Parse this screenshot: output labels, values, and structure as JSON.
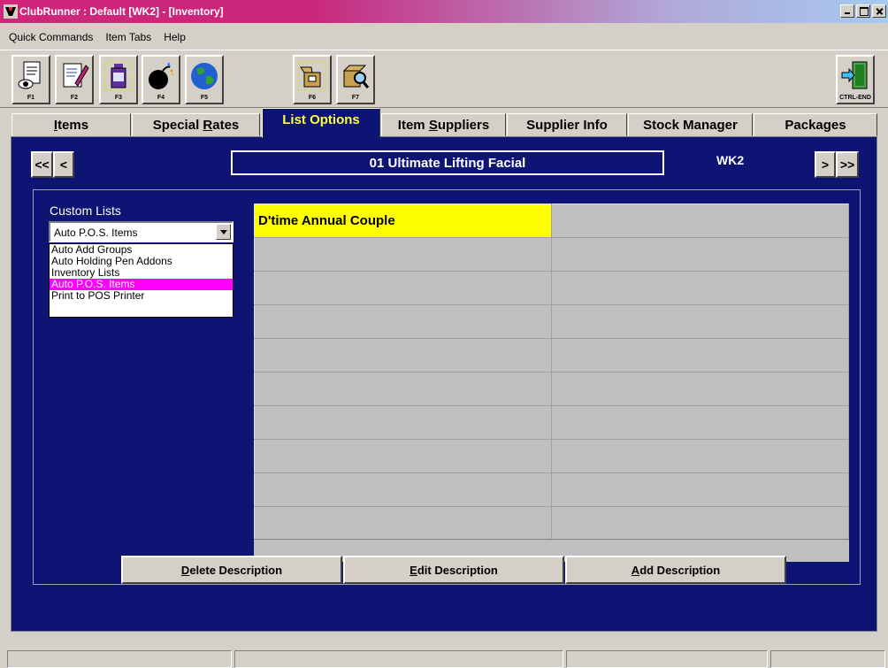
{
  "window": {
    "title": "ClubRunner : Default [WK2] - [Inventory]"
  },
  "menu": {
    "items": [
      "Quick Commands",
      "Item Tabs",
      "Help"
    ]
  },
  "toolbar": {
    "buttons": [
      {
        "key": "F1",
        "icon": "view-document-icon"
      },
      {
        "key": "F2",
        "icon": "edit-document-icon"
      },
      {
        "key": "F3",
        "icon": "inventory-bottle-icon"
      },
      {
        "key": "F4",
        "icon": "bomb-icon"
      },
      {
        "key": "F5",
        "icon": "globe-icon"
      },
      {
        "key": "F6",
        "icon": "open-box-icon"
      },
      {
        "key": "F7",
        "icon": "search-box-icon"
      }
    ],
    "exit_key": "CTRL-END"
  },
  "tabs": {
    "items": {
      "accel": "I",
      "rest": "tems"
    },
    "special_rates": {
      "before": "Special ",
      "accel": "R",
      "rest": "ates"
    },
    "list_options": "List Options",
    "item_suppliers": {
      "before": "Item ",
      "accel": "S",
      "rest": "uppliers"
    },
    "supplier_info": "Supplier Info",
    "stock_manager": "Stock Manager",
    "packages": "Packages"
  },
  "nav": {
    "first": "<<",
    "prev": "<",
    "next": ">",
    "last": ">>",
    "item_title": "01 Ultimate Lifting Facial",
    "workstation": "WK2"
  },
  "custom_lists": {
    "label": "Custom Lists",
    "selected": "Auto P.O.S. Items",
    "options": [
      "Auto Add Groups",
      "Auto Holding Pen Addons",
      "Inventory Lists",
      "Auto P.O.S. Items",
      "Print to POS Printer"
    ],
    "selected_index": 3
  },
  "grid": {
    "rows": [
      [
        "D'time Annual Couple",
        ""
      ],
      [
        "",
        ""
      ],
      [
        "",
        ""
      ],
      [
        "",
        ""
      ],
      [
        "",
        ""
      ],
      [
        "",
        ""
      ],
      [
        "",
        ""
      ],
      [
        "",
        ""
      ],
      [
        "",
        ""
      ],
      [
        "",
        ""
      ]
    ]
  },
  "actions": {
    "delete": {
      "accel": "D",
      "rest": "elete Description"
    },
    "edit": {
      "accel": "E",
      "rest": "dit Description"
    },
    "add": {
      "accel": "A",
      "rest": "dd Description"
    }
  },
  "colors": {
    "panel": "#0d1473",
    "active_tab_text": "#ffff40",
    "highlight_cell": "#ffff00",
    "list_selection": "#ff00ff"
  }
}
